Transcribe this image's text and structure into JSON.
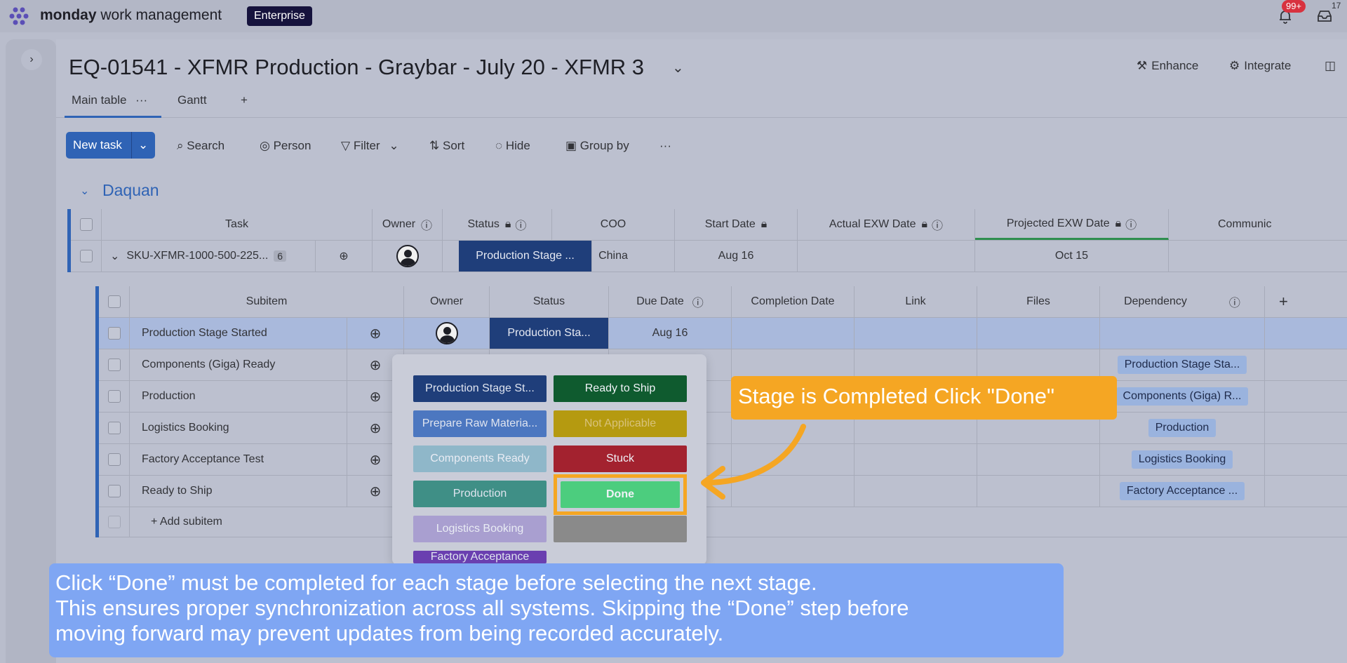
{
  "topbar": {
    "brand_bold": "monday",
    "brand_rest": "work management",
    "plan_badge": "Enterprise",
    "notifications_badge": "99+",
    "inbox_badge": "17"
  },
  "board": {
    "title": "EQ-01541 - XFMR Production - Graybar - July 20 - XFMR 3",
    "enhance": "Enhance",
    "integrate": "Integrate",
    "tabs": [
      "Main table",
      "Gantt",
      "+"
    ],
    "tab_more": "···"
  },
  "toolbar": {
    "new_task": "New task",
    "search": "Search",
    "person": "Person",
    "filter": "Filter",
    "sort": "Sort",
    "hide": "Hide",
    "group_by": "Group by",
    "more": "···"
  },
  "group": {
    "title": "Daquan",
    "columns": [
      "Task",
      "Owner",
      "Status",
      "COO",
      "Start Date",
      "Actual EXW Date",
      "Projected EXW Date",
      "Communic"
    ],
    "item": {
      "name": "SKU-XFMR-1000-500-225...",
      "subitem_count": "6",
      "status": "Production Stage ...",
      "coo": "China",
      "start_date": "Aug 16",
      "projected_exw": "Oct 15"
    }
  },
  "subitems": {
    "columns": [
      "Subitem",
      "Owner",
      "Status",
      "Due Date",
      "Completion Date",
      "Link",
      "Files",
      "Dependency",
      "+"
    ],
    "rows": [
      {
        "name": "Production Stage Started",
        "status": "Production Sta...",
        "due": "Aug 16",
        "dependency": ""
      },
      {
        "name": "Components (Giga) Ready",
        "status": "",
        "due": "",
        "dependency": "Production Stage Sta..."
      },
      {
        "name": "Production",
        "status": "",
        "due": "",
        "dependency": "Components (Giga) R..."
      },
      {
        "name": "Logistics Booking",
        "status": "",
        "due": "",
        "dependency": "Production"
      },
      {
        "name": "Factory Acceptance Test",
        "status": "",
        "due": "",
        "dependency": "Logistics Booking"
      },
      {
        "name": "Ready to Ship",
        "status": "",
        "due": "",
        "dependency": "Factory Acceptance ..."
      }
    ],
    "add_subitem": "+ Add subitem"
  },
  "status_picker": {
    "left": [
      {
        "label": "Production Stage St...",
        "color": "#1f3e7a"
      },
      {
        "label": "Prepare Raw Materia...",
        "color": "#4c77c0"
      },
      {
        "label": "Components Ready",
        "color": "#8fb7c9"
      },
      {
        "label": "Production",
        "color": "#3f8f86"
      },
      {
        "label": "Logistics Booking",
        "color": "#a99fd0"
      },
      {
        "label": "Factory Acceptance",
        "color": "#6a3fb0"
      }
    ],
    "right": [
      {
        "label": "Ready to Ship",
        "color": "#0f5b2f"
      },
      {
        "label": "Not Applicable",
        "color": "#b59a10"
      },
      {
        "label": "Stuck",
        "color": "#a3222f"
      },
      {
        "label": "Done",
        "color": "#4ccd7e"
      },
      {
        "label": "",
        "color": "#8a8a8a"
      }
    ]
  },
  "callouts": {
    "orange": "Stage is Completed Click \"Done\"",
    "blue_lines": [
      "Click “Done” must be completed for each stage before selecting the next stage.",
      "This ensures proper synchronization across all systems. Skipping the “Done” step before",
      "moving forward may prevent updates from being recorded accurately."
    ]
  }
}
